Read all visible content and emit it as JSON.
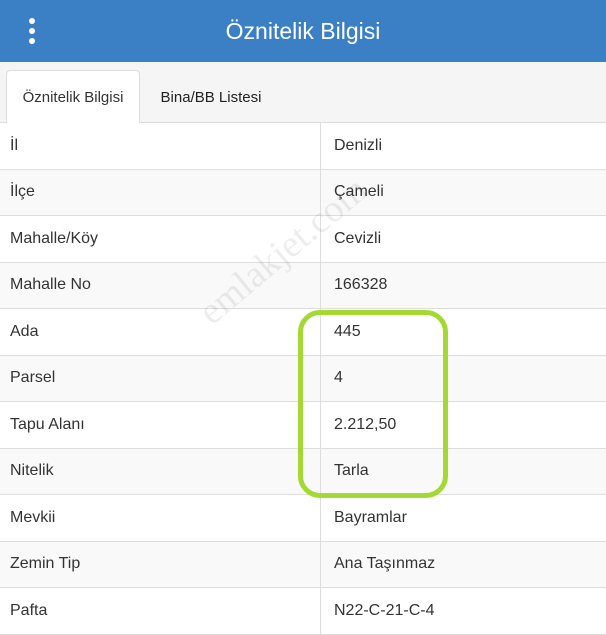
{
  "header": {
    "title": "Öznitelik Bilgisi",
    "menu_icon": "vertical-ellipsis-icon",
    "background_color": "#3b7fc4"
  },
  "tabs": [
    {
      "label": "Öznitelik Bilgisi",
      "active": true
    },
    {
      "label": "Bina/BB Listesi",
      "active": false
    }
  ],
  "table": {
    "rows": [
      {
        "key": "İl",
        "value": "Denizli"
      },
      {
        "key": "İlçe",
        "value": "Çameli"
      },
      {
        "key": "Mahalle/Köy",
        "value": "Cevizli"
      },
      {
        "key": "Mahalle No",
        "value": "166328"
      },
      {
        "key": "Ada",
        "value": "445"
      },
      {
        "key": "Parsel",
        "value": "4"
      },
      {
        "key": "Tapu Alanı",
        "value": "2.212,50"
      },
      {
        "key": "Nitelik",
        "value": "Tarla"
      },
      {
        "key": "Mevkii",
        "value": "Bayramlar"
      },
      {
        "key": "Zemin Tip",
        "value": "Ana Taşınmaz"
      },
      {
        "key": "Pafta",
        "value": "N22-C-21-C-4"
      }
    ]
  },
  "watermark": {
    "text": "emlakjet.com"
  },
  "highlight": {
    "color": "#a4d934"
  }
}
